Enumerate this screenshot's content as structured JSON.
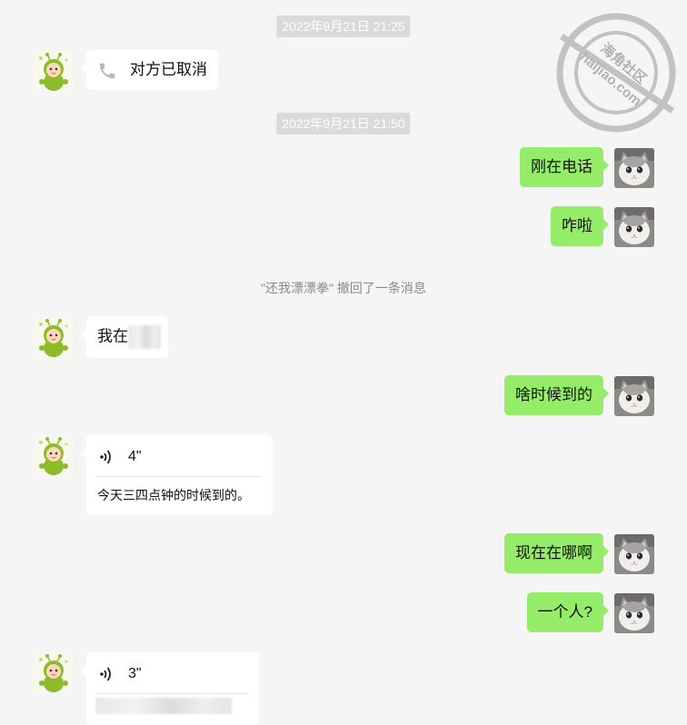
{
  "chat": {
    "timestamps": [
      "2022年9月21日 21:25",
      "2022年9月21日 21:50"
    ],
    "recall_notice": "\"还我漂漂拳\" 撤回了一条消息",
    "messages": {
      "m1": {
        "text": "对方已取消",
        "icon": "phone-icon"
      },
      "m2": {
        "text": "刚在电话"
      },
      "m3": {
        "text": "咋啦"
      },
      "m4": {
        "text": "我在"
      },
      "m5": {
        "text": "啥时候到的"
      },
      "m6": {
        "duration": "4\"",
        "transcript": "今天三四点钟的时候到的。",
        "icon": "voice-icon"
      },
      "m7": {
        "text": "现在在哪啊"
      },
      "m8": {
        "text": "一个人?"
      },
      "m9": {
        "duration": "3\"",
        "icon": "voice-icon"
      }
    }
  },
  "watermark": {
    "text": "海角社区",
    "domain": "haijiao.com"
  },
  "colors": {
    "incoming": "#ffffff",
    "outgoing": "#95ec69",
    "background": "#f5f5f5"
  }
}
